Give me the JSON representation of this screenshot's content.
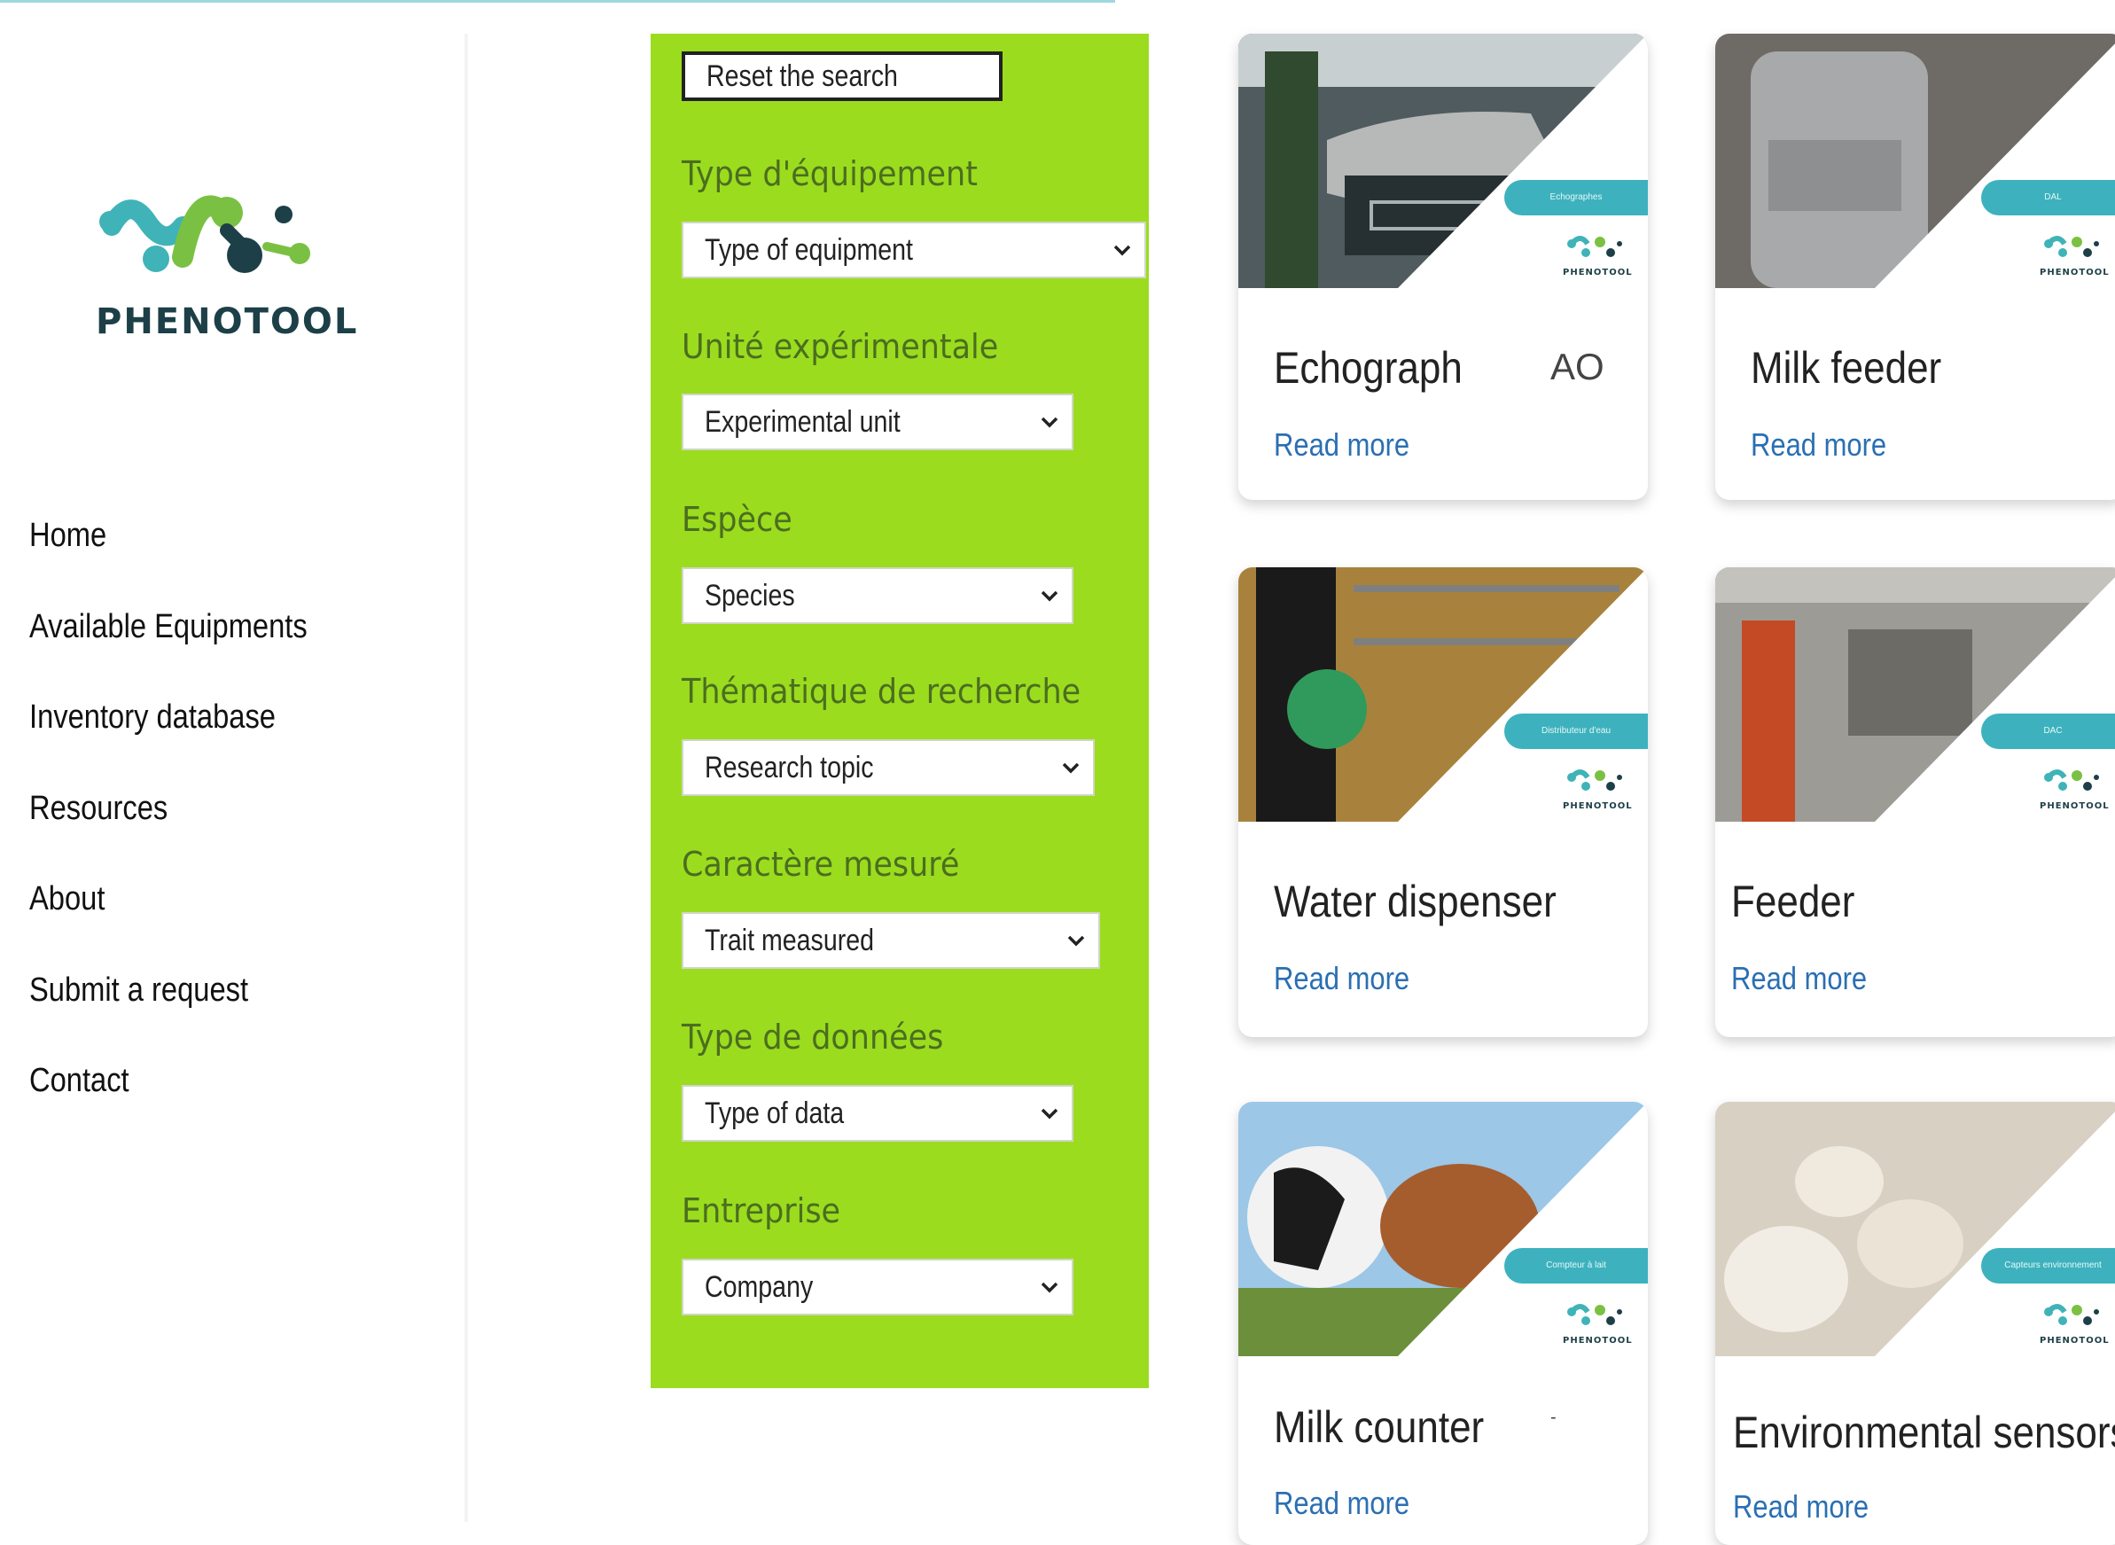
{
  "brand": {
    "name": "PHENOTOOL"
  },
  "nav": {
    "items": [
      {
        "label": "Home"
      },
      {
        "label": "Available Equipments"
      },
      {
        "label": "Inventory database"
      },
      {
        "label": "Resources"
      },
      {
        "label": "About"
      },
      {
        "label": "Submit a request"
      },
      {
        "label": "Contact"
      }
    ]
  },
  "filters": {
    "reset_label": "Reset the search",
    "groups": [
      {
        "label": "Type d'équipement",
        "selected": "Type of equipment"
      },
      {
        "label": "Unité expérimentale",
        "selected": "Experimental unit"
      },
      {
        "label": "Espèce",
        "selected": "Species"
      },
      {
        "label": "Thématique de recherche",
        "selected": "Research topic"
      },
      {
        "label": "Caractère mesuré",
        "selected": "Trait measured"
      },
      {
        "label": "Type de données",
        "selected": "Type of data"
      },
      {
        "label": "Entreprise",
        "selected": "Company"
      }
    ]
  },
  "cards": [
    {
      "title": "Echograph",
      "link": "Read more",
      "badge": "Echographes",
      "extra": "AO"
    },
    {
      "title": "Milk feeder",
      "link": "Read more",
      "badge": "DAL"
    },
    {
      "title": "Water dispenser",
      "link": "Read more",
      "badge": "Distributeur d'eau"
    },
    {
      "title": "Feeder",
      "link": "Read more",
      "badge": "DAC"
    },
    {
      "title": "Milk counter",
      "link": "Read more",
      "badge": "Compteur à lait",
      "extra": "-"
    },
    {
      "title": "Environmental sensors",
      "link": "Read more",
      "badge": "Capteurs environnement"
    }
  ],
  "colors": {
    "filter_panel": "#9bdc1f",
    "filter_label": "#4b6e1f",
    "link": "#2a6fb3",
    "logo_teal": "#3fb3b8",
    "logo_green": "#7ac143",
    "badge": "#3db2be"
  },
  "icons": [
    "phenotool-logo-icon",
    "chevron-down-icon"
  ]
}
